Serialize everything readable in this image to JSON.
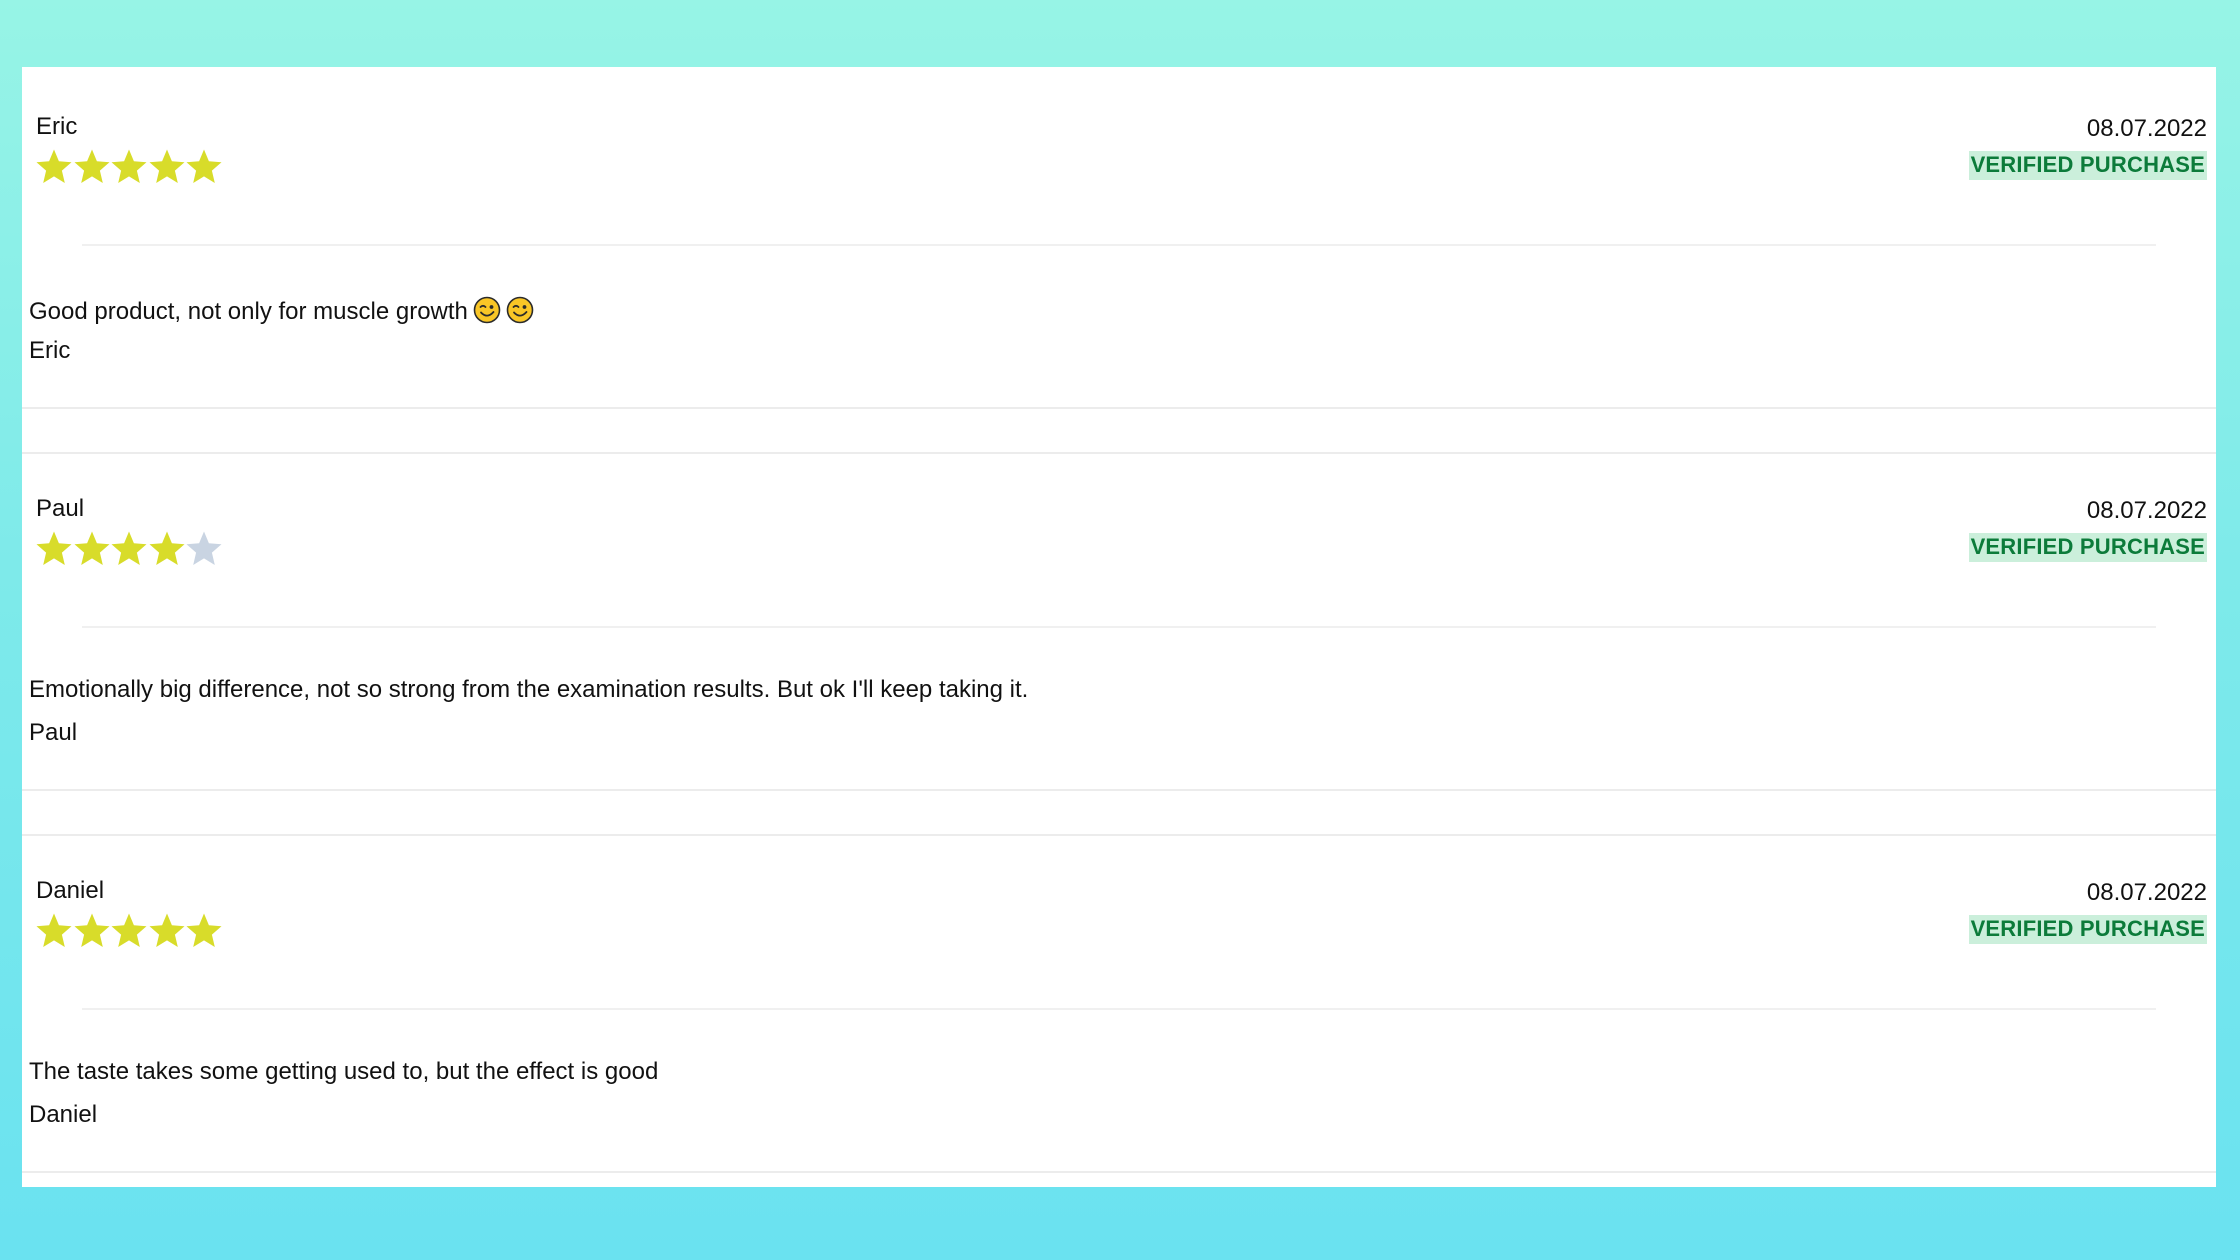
{
  "reviews": [
    {
      "name": "Eric",
      "rating": 5,
      "max_rating": 5,
      "date": "08.07.2022",
      "badge": "VERIFIED PURCHASE",
      "comment": "Good product, not only for muscle growth",
      "comment_emojis": [
        "winking-face-emoji",
        "winking-face-emoji"
      ],
      "signature": "Eric"
    },
    {
      "name": "Paul",
      "rating": 4,
      "max_rating": 5,
      "date": "08.07.2022",
      "badge": "VERIFIED PURCHASE",
      "comment": "Emotionally big difference, not so strong from the examination results. But ok I'll keep taking it.",
      "comment_emojis": [],
      "signature": "Paul"
    },
    {
      "name": "Daniel",
      "rating": 5,
      "max_rating": 5,
      "date": "08.07.2022",
      "badge": "VERIFIED PURCHASE",
      "comment": "The taste takes some getting used to, but the effect is good",
      "comment_emojis": [],
      "signature": "Daniel"
    }
  ],
  "colors": {
    "star_filled": "#d8dc2a",
    "star_empty": "#c9d4e2",
    "badge_bg": "#cbefdb",
    "badge_text": "#0c7b3a",
    "background_top": "#97f4e6",
    "background_bottom": "#6ae2f0"
  }
}
